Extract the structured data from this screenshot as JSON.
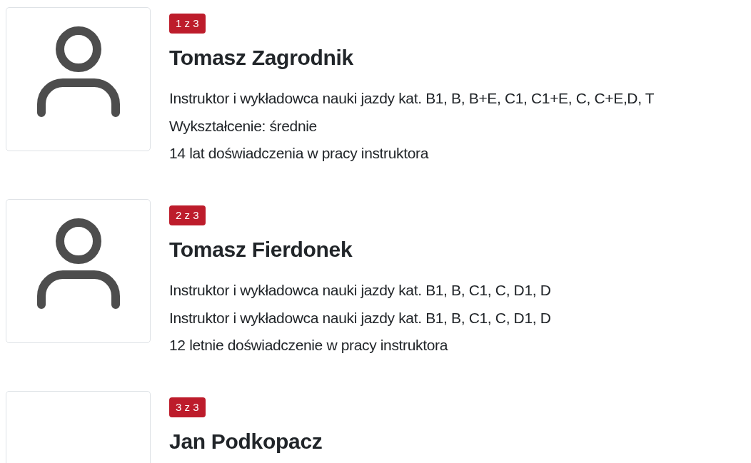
{
  "instructors": [
    {
      "badge": "1 z 3",
      "name": "Tomasz Zagrodnik",
      "avatar": true,
      "lines": [
        "Instruktor i wykładowca nauki jazdy kat. B1, B, B+E, C1, C1+E, C, C+E,D, T",
        "Wykształcenie: średnie",
        "14 lat doświadczenia w pracy instruktora"
      ]
    },
    {
      "badge": "2 z 3",
      "name": "Tomasz Fierdonek",
      "avatar": true,
      "lines": [
        "Instruktor i wykładowca nauki jazdy kat. B1, B, C1, C, D1, D",
        "Instruktor i wykładowca nauki jazdy kat. B1, B, C1, C, D1, D",
        "12 letnie doświadczenie w pracy instruktora"
      ]
    },
    {
      "badge": "3 z 3",
      "name": "Jan Podkopacz",
      "avatar": false
    }
  ]
}
